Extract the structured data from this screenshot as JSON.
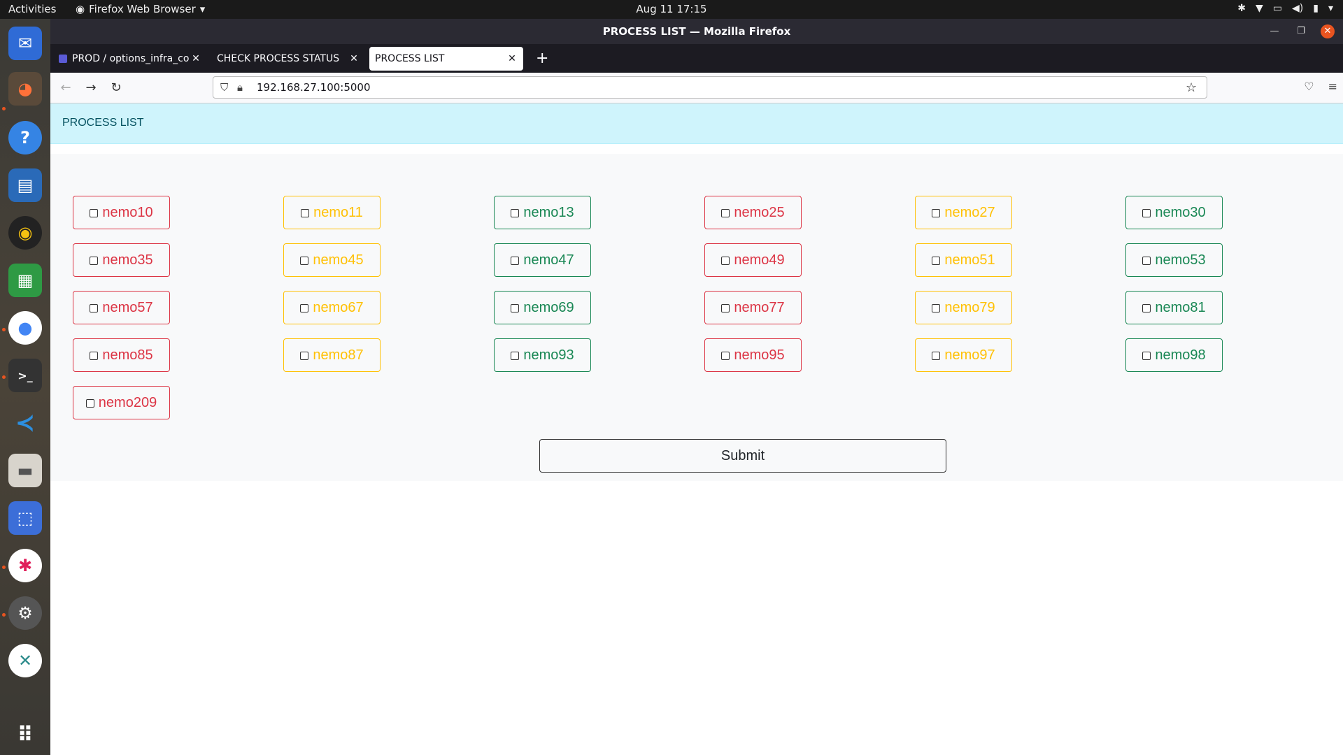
{
  "topbar": {
    "activities": "Activities",
    "app_menu": "Firefox Web Browser",
    "clock": "Aug 11  17:15"
  },
  "dock": {
    "items": [
      "thunderbird-icon",
      "firefox-icon",
      "help-icon",
      "writer-icon",
      "rhythmbox-icon",
      "calc-icon",
      "chrome-icon",
      "terminal-icon",
      "vscode-icon",
      "files-icon",
      "screenshot-icon",
      "slack-icon",
      "settings-icon",
      "remote-desktop-icon",
      "app-grid-icon"
    ]
  },
  "window": {
    "title": "PROCESS LIST — Mozilla Firefox"
  },
  "tabs": [
    {
      "label": "PROD / options_infra_co"
    },
    {
      "label": "CHECK PROCESS STATUS"
    },
    {
      "label": "PROCESS LIST"
    }
  ],
  "navbar": {
    "url": "192.168.27.100:5000"
  },
  "page": {
    "header": "PROCESS LIST",
    "submit_label": "Submit",
    "processes": [
      {
        "label": "nemo10",
        "color": "#dc3545"
      },
      {
        "label": "nemo11",
        "color": "#ffc107"
      },
      {
        "label": "nemo13",
        "color": "#198754"
      },
      {
        "label": "nemo25",
        "color": "#dc3545"
      },
      {
        "label": "nemo27",
        "color": "#ffc107"
      },
      {
        "label": "nemo30",
        "color": "#198754"
      },
      {
        "label": "nemo35",
        "color": "#dc3545"
      },
      {
        "label": "nemo45",
        "color": "#ffc107"
      },
      {
        "label": "nemo47",
        "color": "#198754"
      },
      {
        "label": "nemo49",
        "color": "#dc3545"
      },
      {
        "label": "nemo51",
        "color": "#ffc107"
      },
      {
        "label": "nemo53",
        "color": "#198754"
      },
      {
        "label": "nemo57",
        "color": "#dc3545"
      },
      {
        "label": "nemo67",
        "color": "#ffc107"
      },
      {
        "label": "nemo69",
        "color": "#198754"
      },
      {
        "label": "nemo77",
        "color": "#dc3545"
      },
      {
        "label": "nemo79",
        "color": "#ffc107"
      },
      {
        "label": "nemo81",
        "color": "#198754"
      },
      {
        "label": "nemo85",
        "color": "#dc3545"
      },
      {
        "label": "nemo87",
        "color": "#ffc107"
      },
      {
        "label": "nemo93",
        "color": "#198754"
      },
      {
        "label": "nemo95",
        "color": "#dc3545"
      },
      {
        "label": "nemo97",
        "color": "#ffc107"
      },
      {
        "label": "nemo98",
        "color": "#198754"
      },
      {
        "label": "nemo209",
        "color": "#dc3545"
      }
    ]
  }
}
